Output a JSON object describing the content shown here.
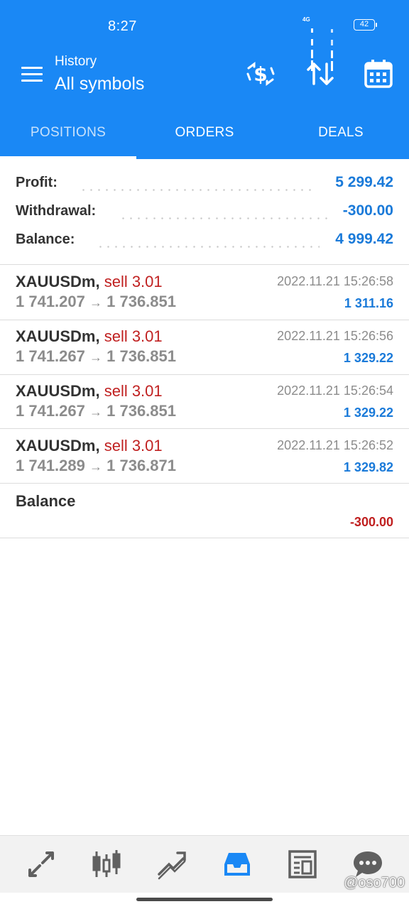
{
  "status": {
    "time": "8:27",
    "network": "4G",
    "battery": "42"
  },
  "header": {
    "subtitle": "History",
    "title": "All symbols",
    "icons": [
      "deposit-icon",
      "sort-icon",
      "calendar-icon"
    ]
  },
  "tabs": [
    {
      "label": "POSITIONS",
      "active": true
    },
    {
      "label": "ORDERS",
      "active": false
    },
    {
      "label": "DEALS",
      "active": false
    }
  ],
  "summary": {
    "profit_label": "Profit:",
    "profit_value": "5 299.42",
    "withdrawal_label": "Withdrawal:",
    "withdrawal_value": "-300.00",
    "balance_label": "Balance:",
    "balance_value": "4 999.42"
  },
  "deals": [
    {
      "symbol": "XAUUSDm,",
      "side": "sell 3.01",
      "time": "2022.11.21 15:26:58",
      "open": "1 741.207",
      "arrow": "→",
      "close": "1 736.851",
      "profit": "1 311.16"
    },
    {
      "symbol": "XAUUSDm,",
      "side": "sell 3.01",
      "time": "2022.11.21 15:26:56",
      "open": "1 741.267",
      "arrow": "→",
      "close": "1 736.851",
      "profit": "1 329.22"
    },
    {
      "symbol": "XAUUSDm,",
      "side": "sell 3.01",
      "time": "2022.11.21 15:26:54",
      "open": "1 741.267",
      "arrow": "→",
      "close": "1 736.851",
      "profit": "1 329.22"
    },
    {
      "symbol": "XAUUSDm,",
      "side": "sell 3.01",
      "time": "2022.11.21 15:26:52",
      "open": "1 741.289",
      "arrow": "→",
      "close": "1 736.871",
      "profit": "1 329.82"
    }
  ],
  "balance_entry": {
    "label": "Balance",
    "value": "-300.00"
  },
  "bottom_nav": [
    "quotes-icon",
    "chart-icon",
    "trade-icon",
    "history-icon",
    "news-icon",
    "chat-icon"
  ],
  "watermark": "@oso700",
  "colors": {
    "accent": "#1a88f5",
    "positive": "#1a7ad9",
    "negative": "#c02020"
  }
}
